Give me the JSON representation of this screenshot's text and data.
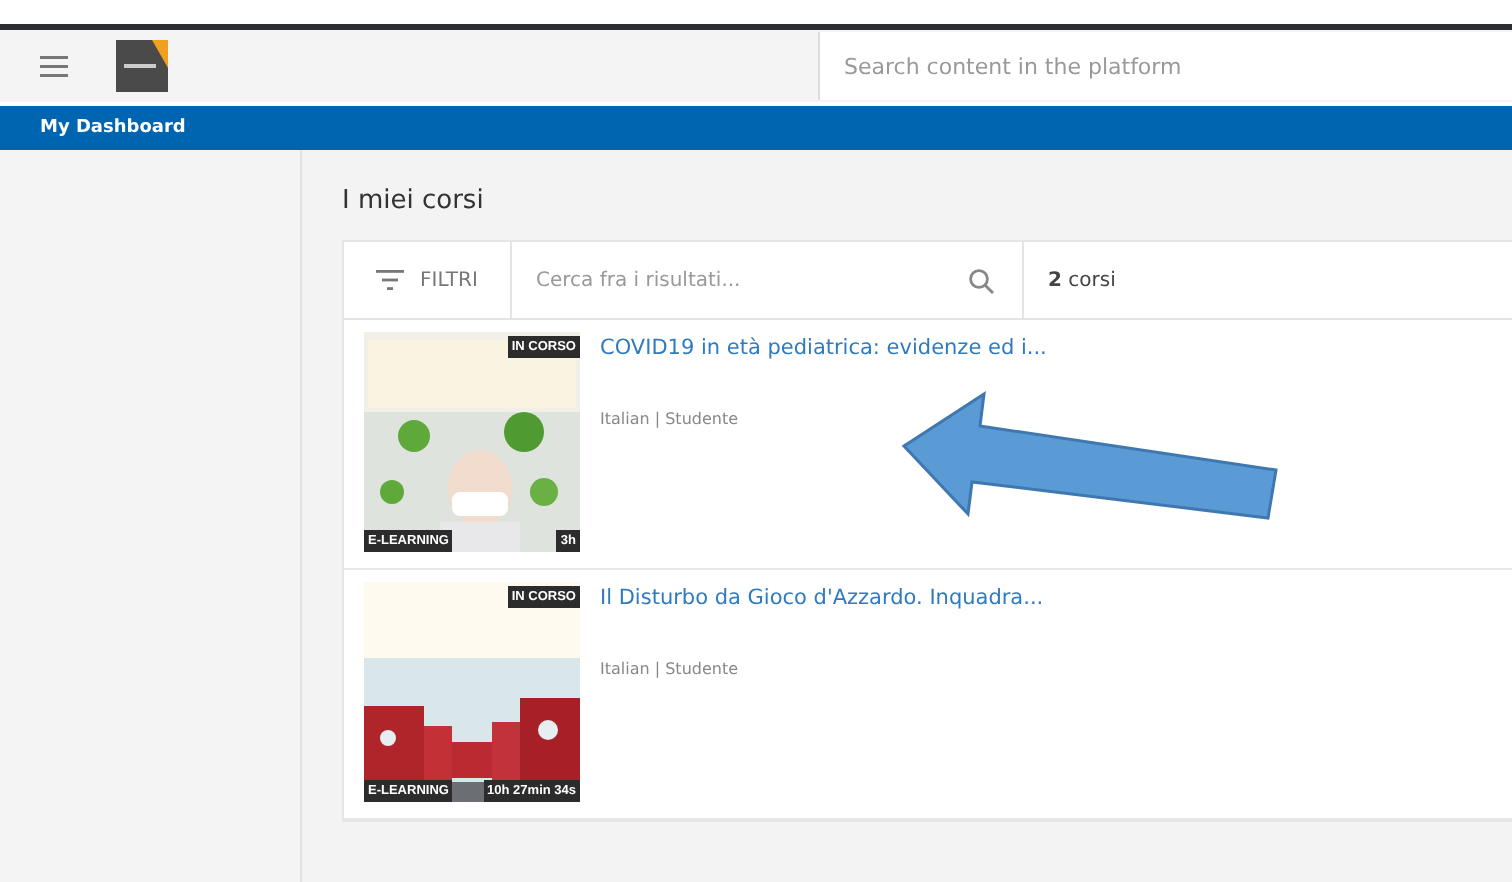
{
  "header": {
    "search": {
      "placeholder": "Search content in the platform"
    }
  },
  "nav_bar": {
    "title": "My Dashboard"
  },
  "page_title": "I miei corsi",
  "toolbar": {
    "filter_label": "FILTRI",
    "search": {
      "placeholder": "Cerca fra i risultati..."
    },
    "count": "**2** corsi"
  },
  "courses": [
    {
      "title": "COVID19 in età pediatrica: evidenze ed i...",
      "meta": "Italian | Studente",
      "status": "IN CORSO",
      "type": "E-LEARNING",
      "duration": "3h",
      "kind": "picture"
    },
    {
      "title": "Il Disturbo da Gioco d'Azzardo. Inquadra...",
      "meta": "Italian | Studente",
      "status": "IN CORSO",
      "type": "E-LEARNING",
      "duration": "10h 27min 34s",
      "kind": "picture"
    }
  ]
}
